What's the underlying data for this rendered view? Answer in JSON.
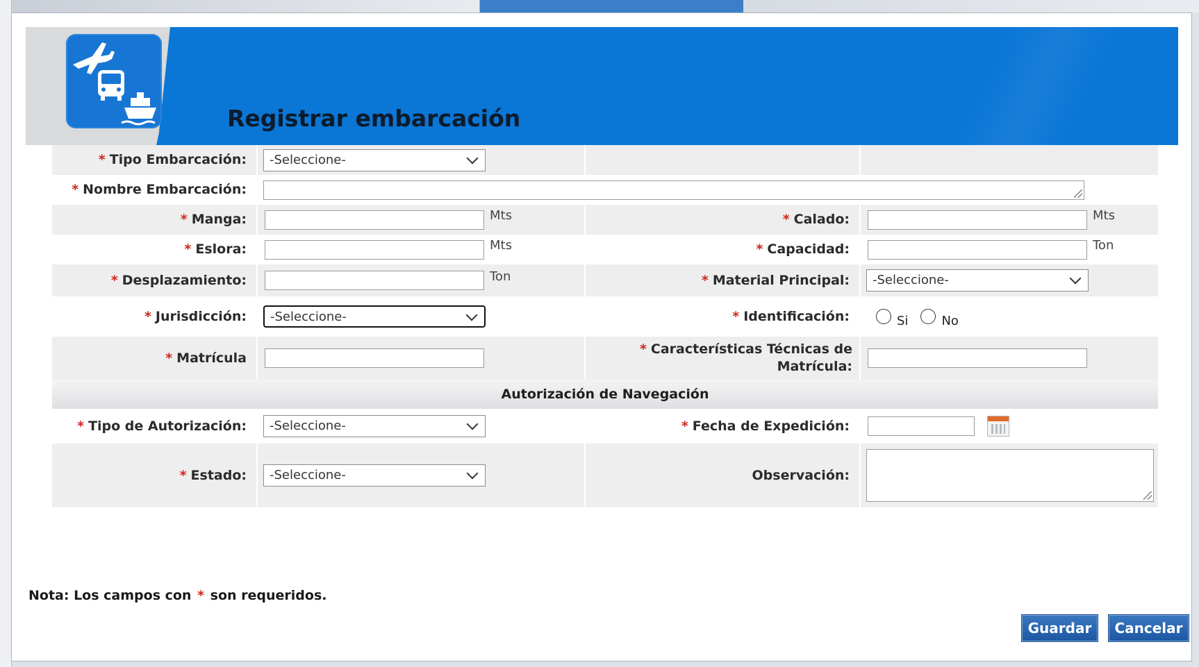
{
  "dialog": {
    "title": "Registrar embarcación",
    "note_prefix": "Nota: Los campos con",
    "note_star": "*",
    "note_suffix": "son requeridos.",
    "buttons": {
      "save": "Guardar",
      "cancel": "Cancelar"
    }
  },
  "form": {
    "required_mark": "*",
    "tipo_embarcacion": {
      "label": "Tipo Embarcación:",
      "value": "-Seleccione-"
    },
    "nombre_embarcacion": {
      "label": "Nombre Embarcación:",
      "value": ""
    },
    "manga": {
      "label": "Manga:",
      "value": "",
      "unit": "Mts"
    },
    "calado": {
      "label": "Calado:",
      "value": "",
      "unit": "Mts"
    },
    "eslora": {
      "label": "Eslora:",
      "value": "",
      "unit": "Mts"
    },
    "capacidad": {
      "label": "Capacidad:",
      "value": "",
      "unit": "Ton"
    },
    "desplazamiento": {
      "label": "Desplazamiento:",
      "value": "",
      "unit": "Ton"
    },
    "material_principal": {
      "label": "Material Principal:",
      "value": "-Seleccione-"
    },
    "jurisdiccion": {
      "label": "Jurisdicción:",
      "value": "-Seleccione-"
    },
    "identificacion": {
      "label": "Identificación:",
      "options": [
        "Si",
        "No"
      ],
      "selected": null
    },
    "matricula": {
      "label": "Matrícula",
      "value": ""
    },
    "caracteristicas": {
      "label_line1": "Características Técnicas de",
      "label_line2": "Matrícula:",
      "value": ""
    },
    "section_title": "Autorización de Navegación",
    "tipo_autorizacion": {
      "label": "Tipo de Autorización:",
      "value": "-Seleccione-"
    },
    "fecha_expedicion": {
      "label": "Fecha de Expedición:",
      "value": ""
    },
    "estado": {
      "label": "Estado:",
      "value": "-Seleccione-"
    },
    "observacion": {
      "label": "Observación:",
      "value": ""
    }
  },
  "colors": {
    "header_blue": "#0a76d6",
    "required_red": "#d0251b",
    "button_blue": "#1d57a3",
    "row_shade": "#eeeeef"
  },
  "icons": [
    "transport-logo-icon",
    "chevron-down-icon",
    "calendar-icon",
    "resize-grip-icon"
  ]
}
